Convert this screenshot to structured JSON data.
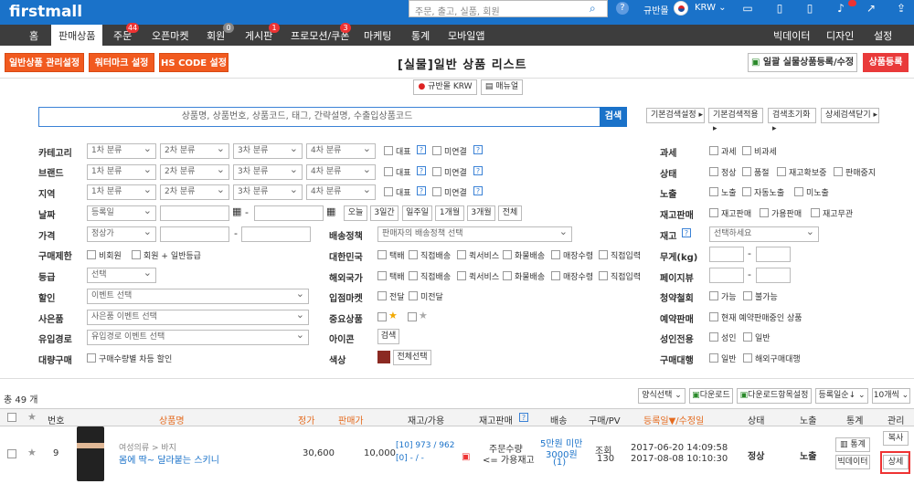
{
  "topbar": {
    "logo": "firstmall",
    "search_placeholder": "주문, 출고, 실품, 회원",
    "country": "규반몰",
    "currency": "KRW ⌄"
  },
  "nav": {
    "items": [
      {
        "label": "홈"
      },
      {
        "label": "판매상품"
      },
      {
        "label": "주문",
        "badge": "44"
      },
      {
        "label": "오픈마켓"
      },
      {
        "label": "회원",
        "badge": "0"
      },
      {
        "label": "게시판",
        "badge": "1"
      },
      {
        "label": "프로모션/쿠폰",
        "badge": "3"
      },
      {
        "label": "마케팅"
      },
      {
        "label": "통계"
      },
      {
        "label": "모바일앱"
      }
    ],
    "right": [
      "빅데이터",
      "디자인",
      "설정"
    ]
  },
  "header": {
    "btn1": "일반상품 관리설정",
    "btn2": "워터마크 설정",
    "btn3": "HS CODE 설정",
    "title": "[실물]일반 상품 리스트",
    "bulk": "일괄 실물상품등록/수정",
    "register": "상품등록"
  },
  "subbar": {
    "country": "규반몰 KRW",
    "manual": "매뉴얼"
  },
  "search": {
    "placeholder": "상품명, 상품번호, 상품코드, 태그, 간략설명, 수출입상품코드",
    "button": "검색",
    "opt1": "기본검색설정 ▸",
    "opt2": "기본검색적용 ▸",
    "opt3": "검색초기화 ▸",
    "opt4": "상세검색닫기 ▸"
  },
  "filters": {
    "category": "카테고리",
    "brand": "브랜드",
    "region": "지역",
    "date": "날짜",
    "price": "가격",
    "purchase_limit": "구매제한",
    "grade": "등급",
    "discount": "할인",
    "gift": "사은품",
    "inflow": "유입경로",
    "bulk_buy": "대량구매",
    "sel1": "1차 분류",
    "sel2": "2차 분류",
    "sel3": "3차 분류",
    "sel4": "4차 분류",
    "rep": "대표",
    "unlinked": "미연결",
    "date_sel": "등록일",
    "price_sel": "정상가",
    "today": "오늘",
    "d3": "3일간",
    "w1": "일주일",
    "m1": "1개월",
    "m3": "3개월",
    "all": "전체",
    "nonmember": "비회원",
    "member_general": "회원 + 일반등급",
    "grade_sel": "선택",
    "event_sel": "이벤트 선택",
    "gift_sel": "사은품 이벤트 선택",
    "inflow_sel": "유입경로 이벤트 선택",
    "bulk_diff": "구매수량별 차등 할인",
    "shipping_policy": "배송정책",
    "shipping_sel": "판매자의 배송정책 선택",
    "korea": "대한민국",
    "overseas": "해외국가",
    "parcel": "택배",
    "direct": "직접배송",
    "quick": "퀵서비스",
    "freight": "화물배송",
    "store": "매장수령",
    "direct_in": "직접입력",
    "openmarket": "입점마켓",
    "delivery": "전달",
    "undelivered": "미전달",
    "important": "중요상품",
    "icon": "아이콘",
    "icon_btn": "검색",
    "color": "색상",
    "color_btn": "전체선택",
    "color_hex": "#8b2a22",
    "tax": "과세",
    "taxable": "과세",
    "nontax": "비과세",
    "status": "상태",
    "normal": "정상",
    "soldout": "품절",
    "restock": "재고확보중",
    "stopsale": "판매중지",
    "exposure": "노출",
    "exposed": "노출",
    "autoexp": "자동노출",
    "unexposed": "미노출",
    "stock_sale": "재고판매",
    "stock_sale1": "재고판매",
    "stock_sale2": "가용판매",
    "stock_sale3": "재고무관",
    "stock": "재고",
    "stock_sel": "선택하세요",
    "weight": "무게(kg)",
    "page_view": "페이지뷰",
    "reserve": "청약철회",
    "possible": "가능",
    "impossible": "불가능",
    "presale": "예약판매",
    "presale_opt": "현재 예약판매중인 상품",
    "adult": "성인전용",
    "adult_opt": "성인",
    "general": "일반",
    "buy_agent": "구매대행",
    "general2": "일반",
    "overseas_agent": "해외구매대행"
  },
  "list": {
    "total": "총 49 개",
    "form_sel": "양식선택 ⌄",
    "download": "다운로드",
    "dl_items": "다운로드항목설정",
    "sort": "등록일순↓ ⌄",
    "count": "10개씩 ⌄"
  },
  "table": {
    "headers": [
      "번호",
      "상품명",
      "정가",
      "판매가",
      "재고/가용",
      "재고판매",
      "배송",
      "구매/PV",
      "등록일▼/수정일",
      "상태",
      "노출",
      "통계",
      "관리"
    ],
    "row": {
      "no": "9",
      "category": "여성의류 > 바지",
      "name": "몸에 딱~ 달라붙는 스키니",
      "list_price": "30,600",
      "price": "10,000",
      "stock1": "[10] 973 / 962",
      "stock2": "[0] - / -",
      "stock_sale": "주문수량",
      "stock_sale2": "<= 가용재고",
      "ship1": "5만원 미만",
      "ship2": "3000원",
      "ship3": "(1)",
      "pv1": "조회",
      "pv2": "130",
      "reg": "2017-06-20 14:09:58",
      "mod": "2017-08-08 10:10:30",
      "status": "정상",
      "exposure": "노출",
      "stat_btn": "통계",
      "bigdata": "빅데이터",
      "copy": "복사",
      "detail": "상세"
    }
  }
}
